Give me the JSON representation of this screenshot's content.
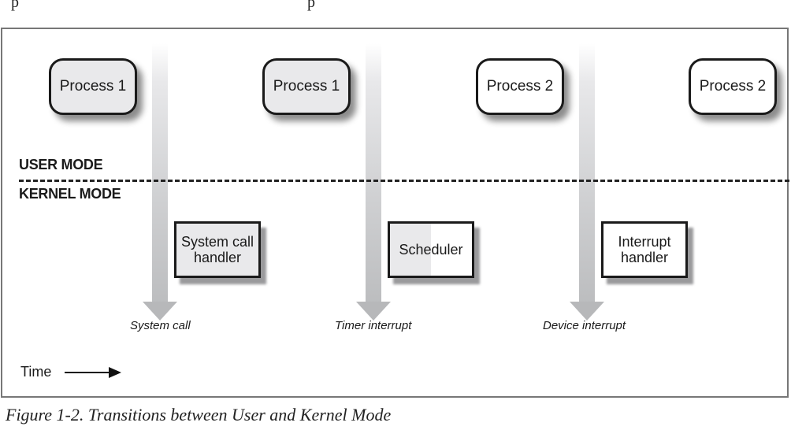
{
  "diagram": {
    "user_mode_label": "USER MODE",
    "kernel_mode_label": "KERNEL MODE",
    "processes": [
      {
        "label": "Process 1",
        "style": "shaded"
      },
      {
        "label": "Process 1",
        "style": "shaded"
      },
      {
        "label": "Process 2",
        "style": "plain"
      },
      {
        "label": "Process 2",
        "style": "plain"
      }
    ],
    "handlers": [
      {
        "label_line1": "System call",
        "label_line2": "handler"
      },
      {
        "label_line1": "Scheduler",
        "label_line2": ""
      },
      {
        "label_line1": "Interrupt",
        "label_line2": "handler"
      }
    ],
    "events": [
      {
        "label": "System call"
      },
      {
        "label": "Timer interrupt"
      },
      {
        "label": "Device interrupt"
      }
    ],
    "time_label": "Time"
  },
  "caption": "Figure 1-2. Transitions between User and Kernel Mode",
  "colors": {
    "shaded_fill": "#e9e9eb",
    "arrow_gray": "#b7b8ba",
    "outline": "#1a1a1a"
  }
}
